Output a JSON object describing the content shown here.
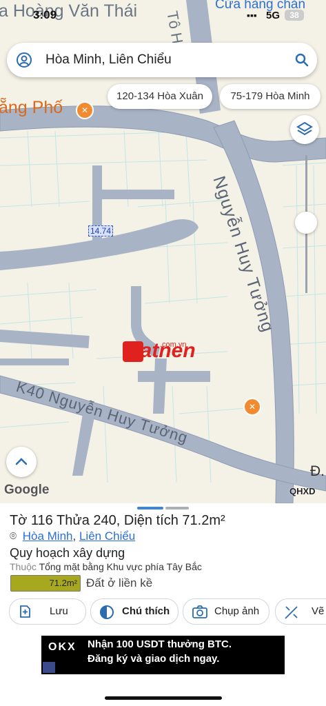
{
  "status_bar": {
    "time": "3:09",
    "network": "5G",
    "battery": "38"
  },
  "map": {
    "labels": {
      "street_top_left": "a Hoàng Văn Thái",
      "street_top_right": "Cửa hàng chăn",
      "street_top_vertical": "Tô H",
      "place_left": "ẵng Phố",
      "road_main": "Nguyễn Huy Tưởng",
      "road_k40": "K40 Nguyễn Huy Tưởng",
      "dimension": "14.74",
      "watermark": "Datnen",
      "watermark_suffix": ".com.vn",
      "edge_letter": "Đ.",
      "google": "Google",
      "qhxd": "QHXD"
    },
    "colors": {
      "road": "#a8b3c6",
      "road_edge": "#8f9cb3",
      "background": "#f4f1e6",
      "parcel_line": "#bfe4e6",
      "brand_red": "#e0221f"
    }
  },
  "search": {
    "value": "Hòa Minh, Liên Chiểu",
    "icon": "search-icon"
  },
  "chips": [
    "120-134 Hòa Xuân",
    "75-179 Hòa Minh"
  ],
  "parcel": {
    "to_label": "Tờ",
    "to": "116",
    "thua_label": "Thửa",
    "thua": "240",
    "area_label": "Diện tích",
    "area": "71.2m²",
    "location": [
      "Hòa Minh",
      "Liên Chiểu"
    ],
    "location_sep": ",",
    "section_title": "Quy hoạch xây dựng",
    "belongs_prefix": "Thuộc",
    "belongs_value": "Tổng mặt bằng Khu vực phía Tây Bắc",
    "zone_area": "71.2m²",
    "zone_type": "Đất ở liền kề",
    "zone_color": "#a8a81e"
  },
  "actions": [
    {
      "label": "Lưu",
      "icon": "add-note-icon"
    },
    {
      "label": "Chú thích",
      "icon": "contrast-icon"
    },
    {
      "label": "Chụp ảnh",
      "icon": "camera-icon"
    },
    {
      "label": "Vẽ",
      "icon": "draw-icon"
    }
  ],
  "ad": {
    "brand": "OKX",
    "line1": "Nhận 100 USDT thưởng BTC.",
    "line2": "Đăng ký và giao dịch ngay."
  }
}
